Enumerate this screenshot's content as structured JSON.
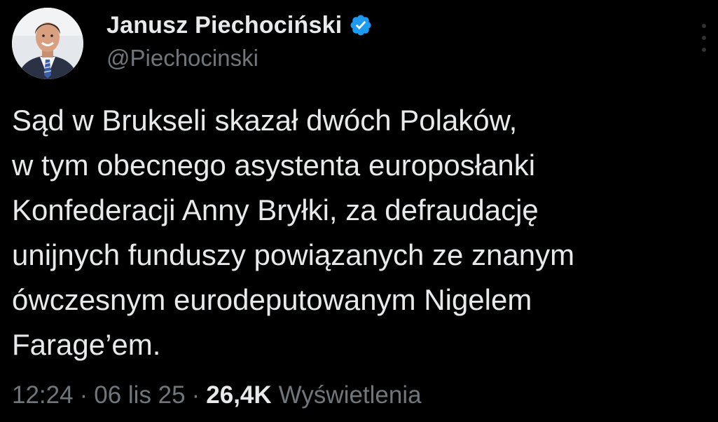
{
  "author": {
    "name": "Janusz Piechociński",
    "handle": "@Piechocinski",
    "verified": true
  },
  "tweet": {
    "lines": [
      "Sąd w Brukseli skazał dwóch Polaków,",
      "w tym obecnego asystenta europosłanki",
      "Konfederacji Anny Bryłki, za defraudację",
      "unijnych funduszy powiązanych ze znanym",
      "ówczesnym eurodeputowanym Nigelem",
      "Farage’em."
    ],
    "time": "12:24",
    "separator": "·",
    "date": "06 lis 25",
    "views_count": "26,4K",
    "views_label": "Wyświetlenia"
  },
  "colors": {
    "background": "#000000",
    "primary_text": "#e7e9ea",
    "secondary_text": "#71767b",
    "verified_badge": "#1d9bf0"
  },
  "icons": {
    "verified": "verified-badge-icon",
    "more": "more-options-icon"
  }
}
